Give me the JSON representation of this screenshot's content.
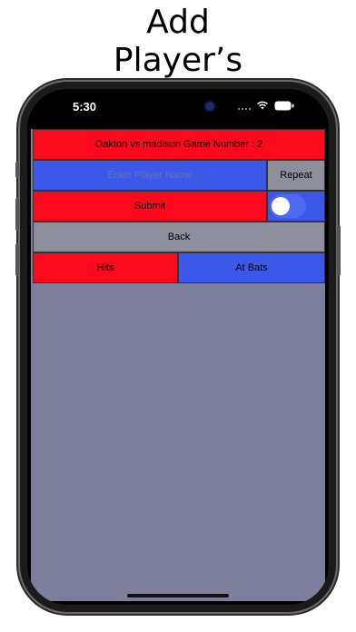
{
  "promo": {
    "title_line1": "Add",
    "title_line2": "Player’s"
  },
  "status_bar": {
    "time": "5:30"
  },
  "game": {
    "title": "Oakton vs madison Game Number : 2"
  },
  "form": {
    "name_placeholder": "Enter Player Name",
    "repeat_label": "Repeat",
    "repeat_toggle": {
      "on": false
    },
    "submit_label": "Submit",
    "back_label": "Back"
  },
  "stats": {
    "hits_label": "Hits",
    "at_bats_label": "At Bats"
  },
  "colors": {
    "red": "#fa0a1c",
    "blue": "#3b58e8",
    "gray": "#8e8f9c",
    "background": "#7c7e9b"
  }
}
